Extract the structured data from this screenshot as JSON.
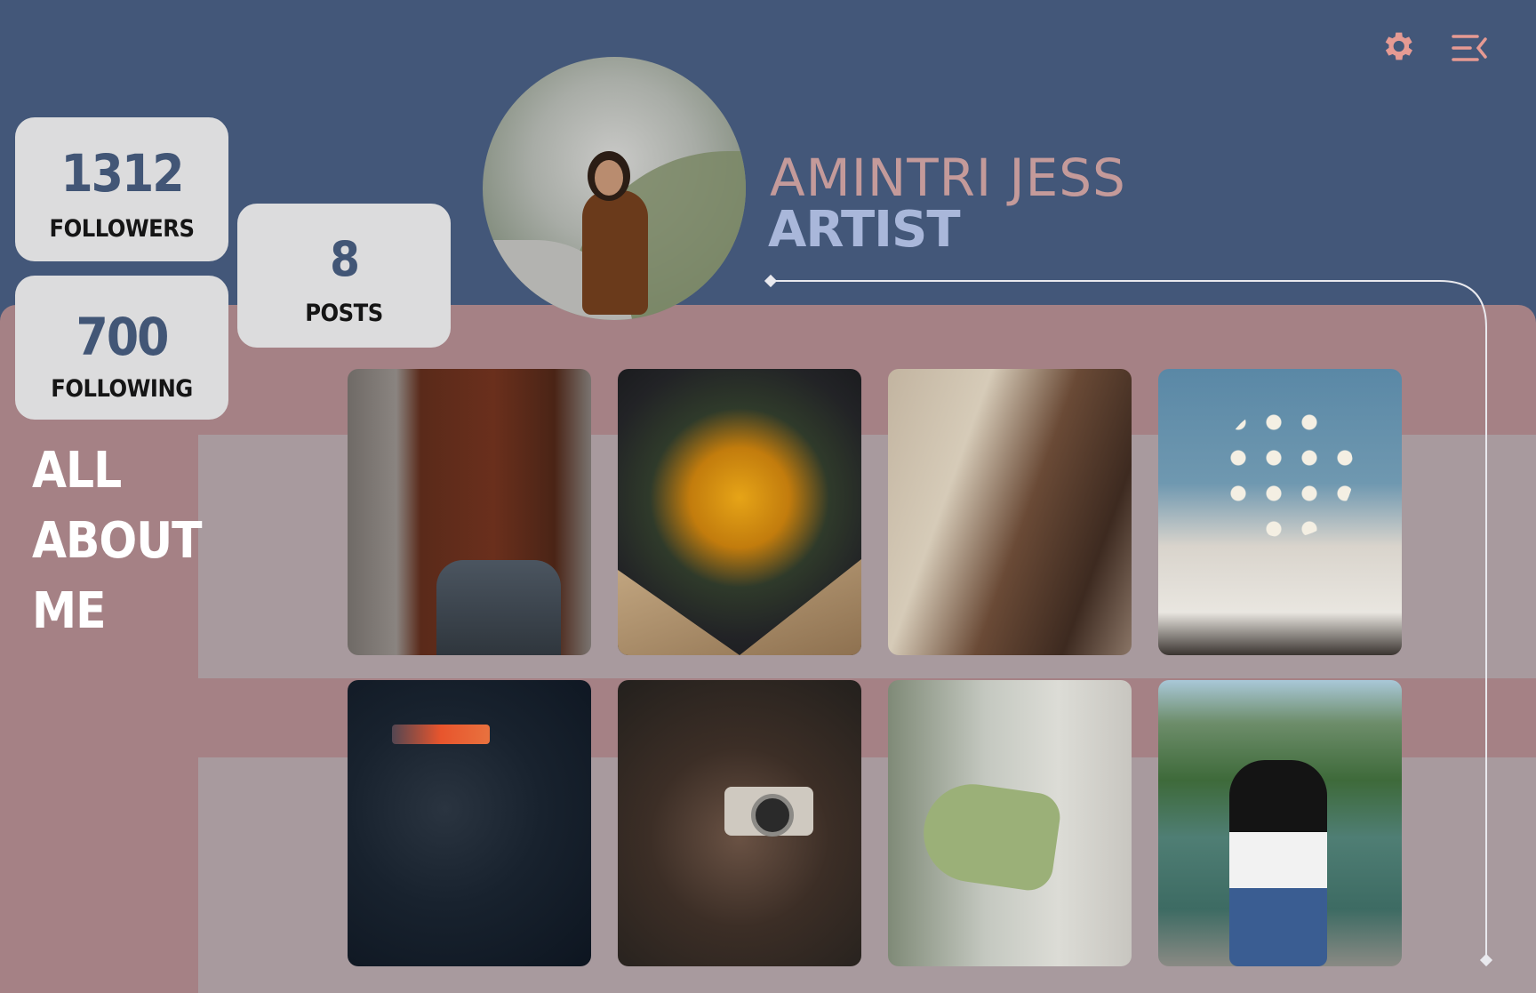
{
  "header": {
    "settings_icon": "gear-icon",
    "menu_icon": "menu-collapse-icon",
    "accent_color": "#e69a93"
  },
  "profile": {
    "name": "AMINTRI  JESS",
    "role": "ARTIST"
  },
  "stats": {
    "followers": {
      "value": "1312",
      "label": "FOLLOWERS"
    },
    "following": {
      "value": "700",
      "label": "FOLLOWING"
    },
    "posts": {
      "value": "8",
      "label": "POSTS"
    }
  },
  "about": {
    "line1": "ALL",
    "line2": "ABOUT",
    "line3": "ME"
  },
  "colors": {
    "header_bg": "#435779",
    "panel_bg": "#a58185",
    "band_bg": "#a89a9e",
    "card_bg": "#dcdcdd",
    "name_color": "#c49a9a",
    "role_color": "#a9b7da"
  }
}
